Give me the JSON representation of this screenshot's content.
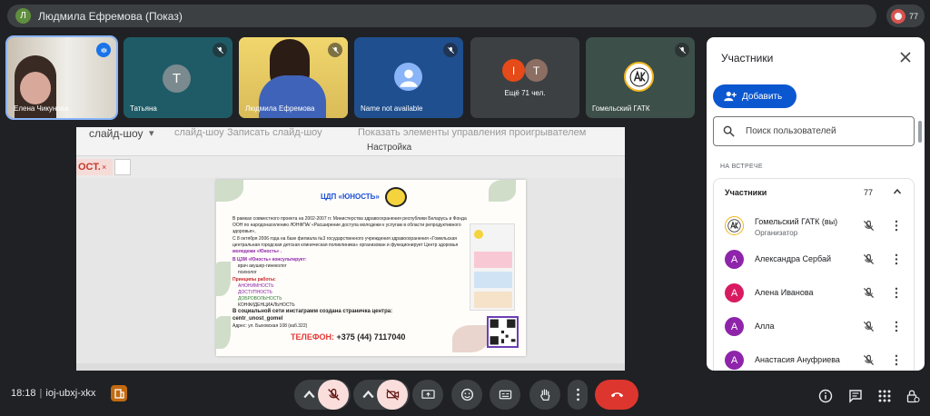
{
  "top": {
    "presenter_initial": "Л",
    "presenter_label": "Людмила Ефремова (Показ)",
    "participant_count": "77"
  },
  "tiles": [
    {
      "name": "Елена Чикунова",
      "initial": "",
      "kind": "video"
    },
    {
      "name": "Татьяна",
      "initial": "Т",
      "kind": "avatar"
    },
    {
      "name": "Людмила Ефремова",
      "initial": "",
      "kind": "video"
    },
    {
      "name": "Name not available",
      "initial": "",
      "kind": "placeholder"
    },
    {
      "name": "Ещё 71 чел.",
      "initial": "I",
      "initial2": "T",
      "kind": "more"
    },
    {
      "name": "Гомельский ГАТК",
      "initial": "",
      "kind": "logo"
    }
  ],
  "presentation": {
    "ribbon_left": "слайд-шоу",
    "ribbon_mid": "слайд-шоу",
    "ribbon_record": "Записать слайд-шоу",
    "ribbon_show_controls": "Показать элементы управления проигрывателем",
    "ribbon_group": "Настройка",
    "tab_label": "ОСТ.",
    "tab_close": "×",
    "slide": {
      "title": "ЦДП «ЮНОСТЬ»",
      "lines": [
        "В рамках совместного проекта на 2002-2007 гг. Министерства здравоохранения республики Беларусь и Фонда",
        "ООН по народонаселению /ЮНФПА/ «Расширение доступа молодежи к услугам в области репродуктивного",
        "здоровья»,",
        "С 8 октября 2006 года на базе филиала №3 государственного учреждения здравоохранения «Гомельская",
        "центральная городская детская клиническая поликлиника» организован и функционирует Центр здоровья",
        "молодежи «Юность» ."
      ],
      "consult_heading": "В ЦЗМ «Юность» консультирует:",
      "consult_items": [
        "врач акушер-гинеколог",
        "психолог"
      ],
      "principles_heading": "Принципы работы:",
      "principles": [
        "АНОНИМНОСТЬ",
        "ДОСТУПНОСТЬ",
        "ДОБРОВОЛЬНОСТЬ",
        "КОНФИДЕНЦИАЛЬНОСТЬ"
      ],
      "instagram_line": "В социальной сети инстаграмм создана страничка центра:",
      "instagram_handle": "centr_unost_gomel",
      "address": "Адрес: ул. Быховская 108 (каб.322)",
      "phone_label": "ТЕЛЕФОН:",
      "phone_value": "+375 (44) 7117040"
    }
  },
  "panel": {
    "title": "Участники",
    "add_label": "Добавить",
    "search_placeholder": "Поиск пользователей",
    "section_label": "НА ВСТРЕЧЕ",
    "list_label": "Участники",
    "list_count": "77",
    "people": [
      {
        "name": "Гомельский ГАТК (вы)",
        "role": "Организатор",
        "initial": "",
        "color": "#ffffff"
      },
      {
        "name": "Александра Сербай",
        "role": "",
        "initial": "А",
        "color": "#8e24aa"
      },
      {
        "name": "Алена Иванова",
        "role": "",
        "initial": "А",
        "color": "#d81b60"
      },
      {
        "name": "Алла",
        "role": "",
        "initial": "А",
        "color": "#8e24aa"
      },
      {
        "name": "Анастасия Ануфриева",
        "role": "",
        "initial": "А",
        "color": "#8e24aa"
      }
    ]
  },
  "bottom": {
    "time": "18:18",
    "meeting_code": "ioj-ubxj-xkx"
  },
  "colors": {
    "background": "#202124",
    "accent": "#0b57d0",
    "danger": "#dc362e"
  }
}
